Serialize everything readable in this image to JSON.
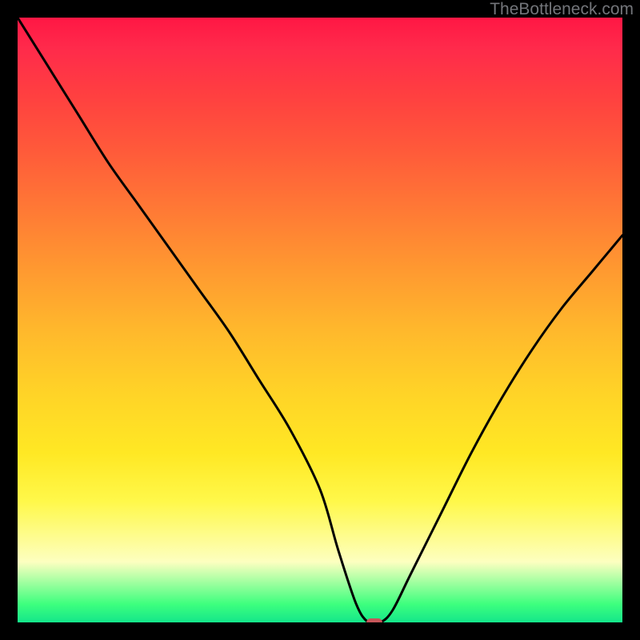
{
  "watermark": "TheBottleneck.com",
  "chart_data": {
    "type": "line",
    "title": "",
    "xlabel": "",
    "ylabel": "",
    "xlim": [
      0,
      100
    ],
    "ylim": [
      0,
      100
    ],
    "series": [
      {
        "name": "bottleneck-curve",
        "x": [
          0,
          5,
          10,
          15,
          20,
          25,
          30,
          35,
          40,
          45,
          50,
          53,
          56,
          58,
          60,
          62,
          65,
          70,
          75,
          80,
          85,
          90,
          95,
          100
        ],
        "y": [
          100,
          92,
          84,
          76,
          69,
          62,
          55,
          48,
          40,
          32,
          22,
          12,
          3,
          0,
          0,
          2,
          8,
          18,
          28,
          37,
          45,
          52,
          58,
          64
        ]
      }
    ],
    "marker_point": {
      "x": 59,
      "y": 0
    },
    "background_gradient_stops": [
      {
        "pos": 0,
        "color": "#ff1744"
      },
      {
        "pos": 5,
        "color": "#ff2a4b"
      },
      {
        "pos": 13,
        "color": "#ff4040"
      },
      {
        "pos": 22,
        "color": "#ff5a3a"
      },
      {
        "pos": 32,
        "color": "#ff7a35"
      },
      {
        "pos": 42,
        "color": "#ff9a30"
      },
      {
        "pos": 52,
        "color": "#ffb92c"
      },
      {
        "pos": 62,
        "color": "#ffd327"
      },
      {
        "pos": 72,
        "color": "#ffe824"
      },
      {
        "pos": 80,
        "color": "#fff84a"
      },
      {
        "pos": 90,
        "color": "#fdffc0"
      },
      {
        "pos": 97,
        "color": "#3dff7e"
      },
      {
        "pos": 100,
        "color": "#14e68a"
      }
    ],
    "marker_color": "#c7565a"
  }
}
